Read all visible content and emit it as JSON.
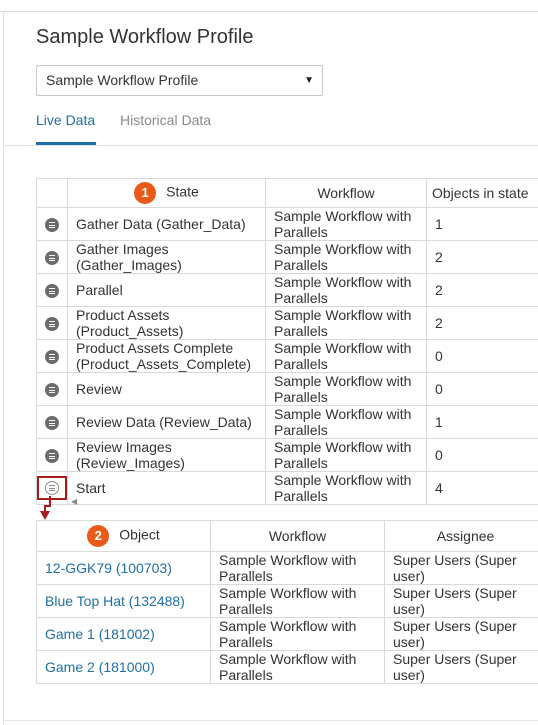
{
  "page": {
    "title": "Sample Workflow Profile"
  },
  "profile_select": {
    "value": "Sample Workflow Profile"
  },
  "tabs": [
    {
      "label": "Live Data",
      "active": true
    },
    {
      "label": "Historical Data",
      "active": false
    }
  ],
  "colors": {
    "accent": "#1e6fa8",
    "badge": "#e95a18",
    "highlight": "#a61c1c"
  },
  "state_table": {
    "badge": "1",
    "columns": [
      "State",
      "Workflow",
      "Objects in state"
    ],
    "rows": [
      {
        "icon": "list-icon",
        "state": [
          "Gather Data (Gather_Data)"
        ],
        "workflow": [
          "Sample Workflow with",
          "Parallels"
        ],
        "count": "1"
      },
      {
        "icon": "list-icon",
        "state": [
          "Gather Images",
          "(Gather_Images)"
        ],
        "workflow": [
          "Sample Workflow with",
          "Parallels"
        ],
        "count": "2"
      },
      {
        "icon": "list-icon",
        "state": [
          "Parallel"
        ],
        "workflow": [
          "Sample Workflow with",
          "Parallels"
        ],
        "count": "2"
      },
      {
        "icon": "list-icon",
        "state": [
          "Product Assets",
          "(Product_Assets)"
        ],
        "workflow": [
          "Sample Workflow with",
          "Parallels"
        ],
        "count": "2"
      },
      {
        "icon": "list-icon",
        "state": [
          "Product Assets Complete",
          "(Product_Assets_Complete)"
        ],
        "workflow": [
          "Sample Workflow with",
          "Parallels"
        ],
        "count": "0"
      },
      {
        "icon": "list-icon",
        "state": [
          "Review"
        ],
        "workflow": [
          "Sample Workflow with",
          "Parallels"
        ],
        "count": "0"
      },
      {
        "icon": "list-icon",
        "state": [
          "Review Data (Review_Data)"
        ],
        "workflow": [
          "Sample Workflow with",
          "Parallels"
        ],
        "count": "1"
      },
      {
        "icon": "list-icon",
        "state": [
          "Review Images",
          "(Review_Images)"
        ],
        "workflow": [
          "Sample Workflow with",
          "Parallels"
        ],
        "count": "0"
      },
      {
        "icon": "list-icon",
        "state": [
          "Start"
        ],
        "workflow": [
          "Sample Workflow with",
          "Parallels"
        ],
        "count": "4"
      }
    ]
  },
  "object_table": {
    "badge": "2",
    "columns": [
      "Object",
      "Workflow",
      "Assignee"
    ],
    "rows": [
      {
        "object": "12-GGK79 (100703)",
        "workflow": [
          "Sample Workflow with",
          "Parallels"
        ],
        "assignee": [
          "Super Users (Super",
          "user)"
        ]
      },
      {
        "object": "Blue Top Hat (132488)",
        "workflow": [
          "Sample Workflow with",
          "Parallels"
        ],
        "assignee": [
          "Super Users (Super",
          "user)"
        ]
      },
      {
        "object": "Game 1 (181002)",
        "workflow": [
          "Sample Workflow with",
          "Parallels"
        ],
        "assignee": [
          "Super Users (Super",
          "user)"
        ]
      },
      {
        "object": "Game 2 (181000)",
        "workflow": [
          "Sample Workflow with",
          "Parallels"
        ],
        "assignee": [
          "Super Users (Super",
          "user)"
        ]
      }
    ]
  }
}
